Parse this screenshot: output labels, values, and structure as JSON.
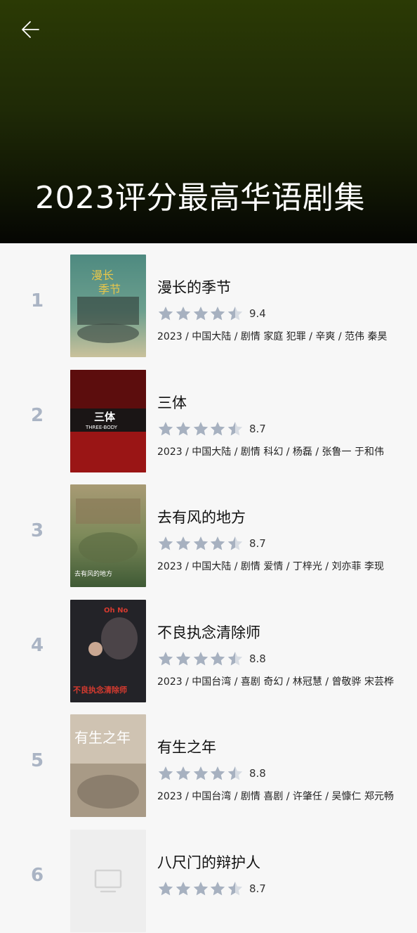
{
  "header": {
    "title": "2023评分最高华语剧集",
    "back_icon": "arrow-left-icon"
  },
  "items": [
    {
      "rank": "1",
      "title": "漫长的季节",
      "rating": 4.5,
      "score": "9.4",
      "meta": "2023 / 中国大陆 / 剧情 家庭 犯罪 / 辛爽 / 范伟 秦昊",
      "poster_color": "#3f6b62"
    },
    {
      "rank": "2",
      "title": "三体",
      "rating": 4.5,
      "score": "8.7",
      "meta": "2023 / 中国大陆 / 剧情 科幻 / 杨磊 / 张鲁一 于和伟",
      "poster_color": "#8c1616"
    },
    {
      "rank": "3",
      "title": "去有风的地方",
      "rating": 4.5,
      "score": "8.7",
      "meta": "2023 / 中国大陆 / 剧情 爱情 / 丁梓光 / 刘亦菲 李现",
      "poster_color": "#7a6a3f"
    },
    {
      "rank": "4",
      "title": "不良执念清除师",
      "rating": 4.5,
      "score": "8.8",
      "meta": "2023 / 中国台湾 / 喜剧 奇幻 / 林冠慧 / 曾敬骅 宋芸桦",
      "poster_color": "#2a2a2e"
    },
    {
      "rank": "5",
      "title": "有生之年",
      "rating": 4.5,
      "score": "8.8",
      "meta": "2023 / 中国台湾 / 剧情 喜剧 / 许肇任 / 吴慷仁 郑元畅",
      "poster_color": "#b7a893"
    },
    {
      "rank": "6",
      "title": "八尺门的辩护人",
      "rating": 4.5,
      "score": "8.7",
      "meta": "",
      "poster_color": "#eeeeee"
    }
  ]
}
